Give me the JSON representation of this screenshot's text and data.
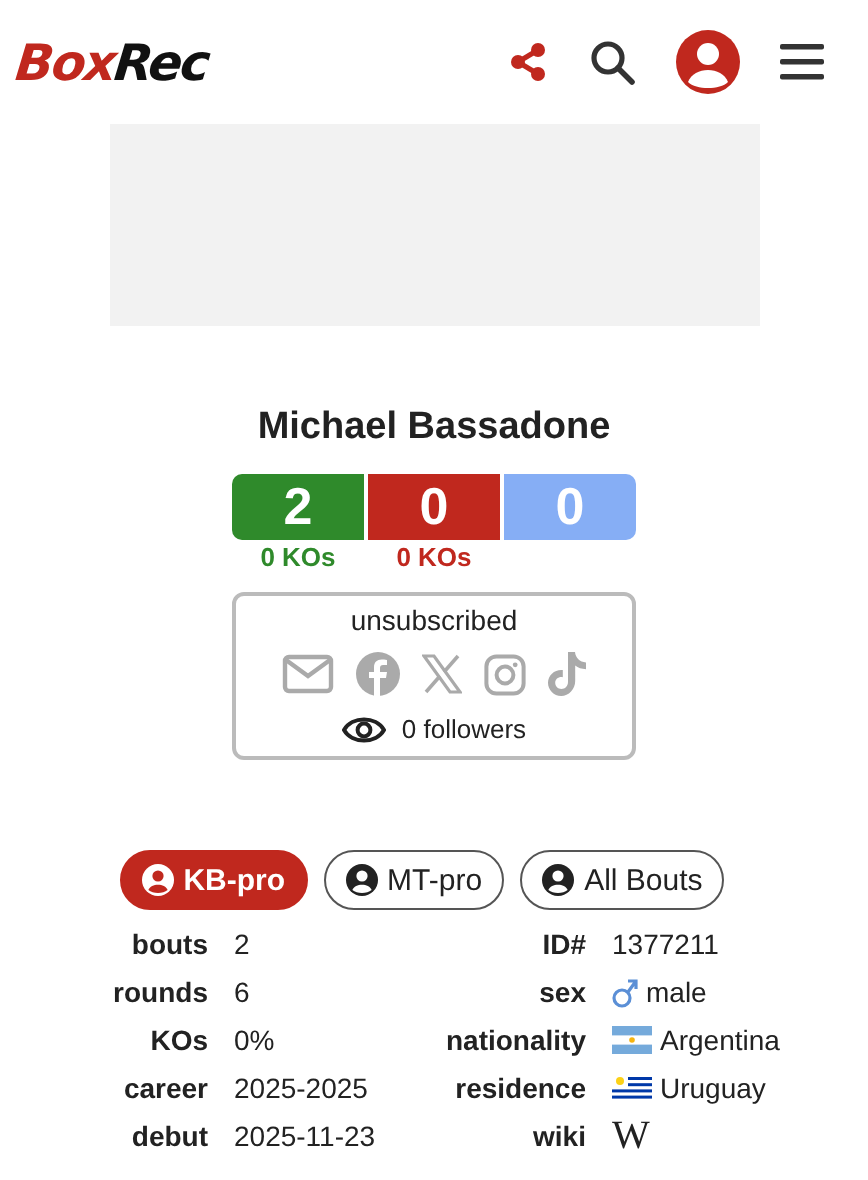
{
  "header": {
    "logo_parts": [
      "Box",
      "Rec"
    ]
  },
  "profile": {
    "name": "Michael Bassadone",
    "record": [
      {
        "kind": "win",
        "value": "2",
        "kos": "0 KOs"
      },
      {
        "kind": "loss",
        "value": "0",
        "kos": "0 KOs"
      },
      {
        "kind": "draw",
        "value": "0"
      }
    ],
    "social": {
      "status": "unsubscribed",
      "followers": "0 followers"
    }
  },
  "tabs": [
    {
      "label": "KB-pro",
      "selected": true
    },
    {
      "label": "MT-pro",
      "selected": false
    },
    {
      "label": "All Bouts",
      "selected": false
    }
  ],
  "stats_left": [
    {
      "label": "bouts",
      "value": "2"
    },
    {
      "label": "rounds",
      "value": "6"
    },
    {
      "label": "KOs",
      "value": "0%"
    },
    {
      "label": "career",
      "value": "2025-2025"
    },
    {
      "label": "debut",
      "value": "2025-11-23"
    }
  ],
  "stats_right": [
    {
      "label": "ID#",
      "kind": "text",
      "value": "1377211"
    },
    {
      "label": "sex",
      "kind": "sex",
      "value": "male"
    },
    {
      "label": "nationality",
      "kind": "flag_ar",
      "value": "Argentina"
    },
    {
      "label": "residence",
      "kind": "flag_uy",
      "value": "Uruguay"
    },
    {
      "label": "wiki",
      "kind": "wiki",
      "value": "W"
    }
  ]
}
